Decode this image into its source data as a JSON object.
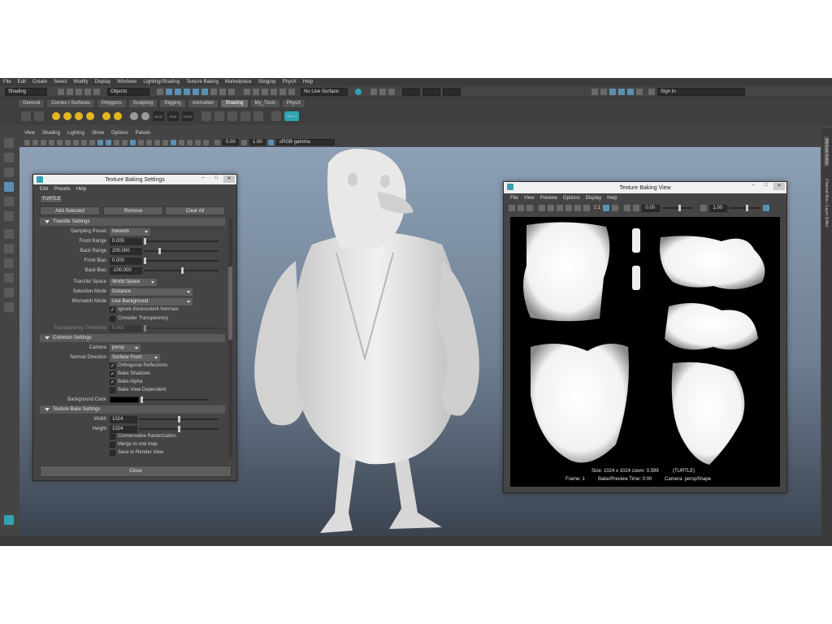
{
  "menubar": [
    "File",
    "Edit",
    "Create",
    "Select",
    "Modify",
    "Display",
    "Windows",
    "Lighting/Shading",
    "Texture Baking",
    "Marketplace",
    "Stingray",
    "PhysX",
    "Help"
  ],
  "statusline": {
    "mode": "Shading",
    "objects": "Objects",
    "live_surface": "No Live Surface",
    "signin": "Sign In"
  },
  "shelf_tabs": [
    "General",
    "Curves / Surfaces",
    "Polygons",
    "Sculpting",
    "Rigging",
    "Animation",
    "Shading",
    "My_Tools",
    "PhysX"
  ],
  "shelf_icon_labels": [
    "DX9",
    "CGFX",
    "GLSL"
  ],
  "shelf_extra_label": "CatPro_E",
  "view_menu": [
    "View",
    "Shading",
    "Lighting",
    "Show",
    "Options",
    "Panels"
  ],
  "view_tools": {
    "value_a": "0.00",
    "value_b": "1.00",
    "color_space": "sRGB gamma"
  },
  "camera_label": "persp",
  "right_sidebar": [
    "Attribute Editor",
    "Channel Box / Layer Editor"
  ],
  "tbs_window": {
    "title": "Texture Baking Settings",
    "menu": [
      "Edit",
      "Presets",
      "Help"
    ],
    "tab": "TURTLE",
    "buttons": [
      "Add Selected",
      "Remove",
      "Clear All"
    ],
    "sections": {
      "transfer": "Transfer Settings",
      "common": "Common Settings",
      "texture": "Texture Bake Settings"
    },
    "fields": {
      "sampling_preset_label": "Sampling Preset",
      "sampling_preset": "Inwards",
      "front_range_label": "Front Range",
      "front_range": "0.000",
      "back_range_label": "Back Range",
      "back_range": "200.000",
      "front_bias_label": "Front Bias",
      "front_bias": "0.000",
      "back_bias_label": "Back Bias",
      "back_bias": "-100.000",
      "transfer_space_label": "Transfer Space",
      "transfer_space": "World Space",
      "selection_mode_label": "Selection Mode",
      "selection_mode": "Distance",
      "mismatch_mode_label": "Mismatch Mode",
      "mismatch_mode": "Use Background",
      "ignore_inconsistent": "Ignore Inconsistent Normals",
      "consider_transparency": "Consider Transparency",
      "transparency_threshold_label": "Transparency Threshold",
      "transparency_threshold": "0.001",
      "camera_label": "Camera",
      "camera": "persp",
      "normal_direction_label": "Normal Direction",
      "normal_direction": "Surface Front",
      "orthogonal_reflections": "Orthogonal Reflections",
      "bake_shadows": "Bake Shadows",
      "bake_alpha": "Bake Alpha",
      "bake_view_dependent": "Bake View Dependent",
      "background_color_label": "Background Color",
      "width_label": "Width",
      "width": "1024",
      "height_label": "Height",
      "height": "1024",
      "conservative_rasterization": "Conservative Rasterization",
      "merge_to_one_map": "Merge to one map",
      "save_to_render_view": "Save to Render View"
    },
    "checks": {
      "ignore_inconsistent": true,
      "consider_transparency": false,
      "orthogonal_reflections": true,
      "bake_shadows": true,
      "bake_alpha": true,
      "bake_view_dependent": false,
      "conservative_rasterization": false,
      "merge_to_one_map": false,
      "save_to_render_view": false
    },
    "close": "Close"
  },
  "tbv_window": {
    "title": "Texture Baking View",
    "menu": [
      "File",
      "View",
      "Preview",
      "Options",
      "Display",
      "Help"
    ],
    "ratio": "1:1",
    "value_a": "0.00",
    "value_b": "1.00",
    "hud_line1_left": "Size: 1024 x 1024  zoom: 0.599",
    "hud_line1_right": "(TURTLE)",
    "hud_line2_a": "Frame: 1",
    "hud_line2_b": "Bake/Preview Time: 0:00",
    "hud_line2_c": "Camera: perspShape"
  },
  "colors": {
    "accent": "#5b8fb4",
    "maya_logo": "#2fa3b0",
    "sun_icon": "#e3b520"
  }
}
